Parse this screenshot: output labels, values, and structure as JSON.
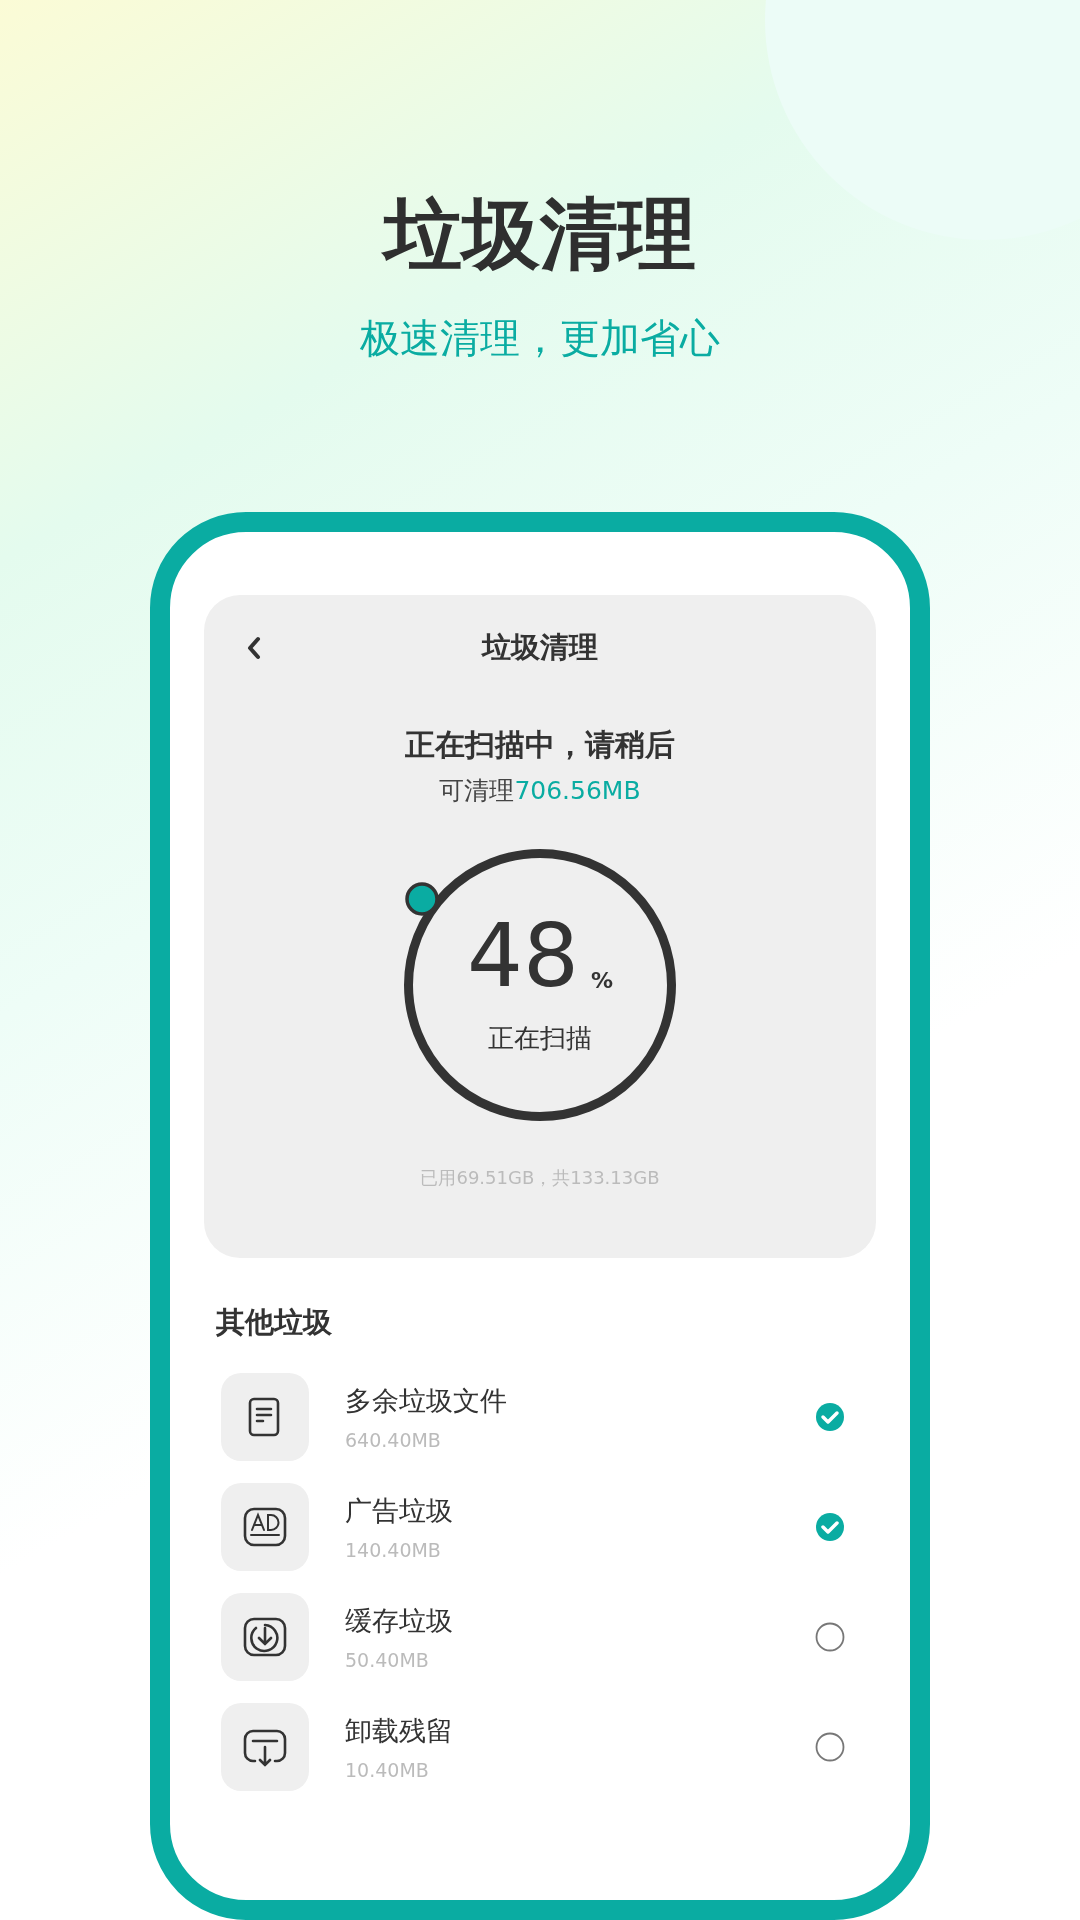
{
  "promo": {
    "title": "垃圾清理",
    "subtitle": "极速清理，更加省心"
  },
  "header": {
    "title": "垃圾清理"
  },
  "scan": {
    "status": "正在扫描中，请稍后",
    "available_label": "可清理",
    "available_value": "706.56MB",
    "percent": "48",
    "percent_sign": "%",
    "progress_label": "正在扫描",
    "storage": "已用69.51GB，共133.13GB"
  },
  "section_title": "其他垃圾",
  "items": [
    {
      "kind": "document",
      "name": "多余垃圾文件",
      "size": "640.40MB",
      "checked": true
    },
    {
      "kind": "ad",
      "name": "广告垃圾",
      "size": "140.40MB",
      "checked": true
    },
    {
      "kind": "cache",
      "name": "缓存垃圾",
      "size": "50.40MB",
      "checked": false
    },
    {
      "kind": "uninstall",
      "name": "卸载残留",
      "size": "10.40MB",
      "checked": false
    }
  ]
}
